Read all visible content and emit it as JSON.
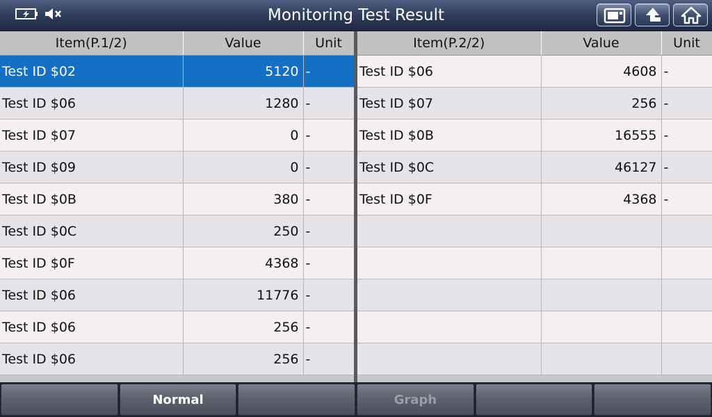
{
  "header": {
    "title": "Monitoring Test Result",
    "status_icons": [
      "battery-charging-icon",
      "speaker-muted-icon"
    ],
    "buttons": [
      "screenshot-icon",
      "back-arrow-icon",
      "home-icon"
    ]
  },
  "left_table": {
    "columns": [
      "Item(P.1/2)",
      "Value",
      "Unit"
    ],
    "rows": [
      {
        "item": "Test ID $02",
        "value": "5120",
        "unit": "-"
      },
      {
        "item": "Test ID $06",
        "value": "1280",
        "unit": "-"
      },
      {
        "item": "Test ID $07",
        "value": "0",
        "unit": "-"
      },
      {
        "item": "Test ID $09",
        "value": "0",
        "unit": "-"
      },
      {
        "item": "Test ID $0B",
        "value": "380",
        "unit": "-"
      },
      {
        "item": "Test ID $0C",
        "value": "250",
        "unit": "-"
      },
      {
        "item": "Test ID $0F",
        "value": "4368",
        "unit": "-"
      },
      {
        "item": "Test ID $06",
        "value": "11776",
        "unit": "-"
      },
      {
        "item": "Test ID $06",
        "value": "256",
        "unit": "-"
      },
      {
        "item": "Test ID $06",
        "value": "256",
        "unit": "-"
      }
    ]
  },
  "right_table": {
    "columns": [
      "Item(P.2/2)",
      "Value",
      "Unit"
    ],
    "rows": [
      {
        "item": "Test ID $06",
        "value": "4608",
        "unit": "-"
      },
      {
        "item": "Test ID $07",
        "value": "256",
        "unit": "-"
      },
      {
        "item": "Test ID $0B",
        "value": "16555",
        "unit": "-"
      },
      {
        "item": "Test ID $0C",
        "value": "46127",
        "unit": "-"
      },
      {
        "item": "Test ID $0F",
        "value": "4368",
        "unit": "-"
      },
      {
        "item": "",
        "value": "",
        "unit": ""
      },
      {
        "item": "",
        "value": "",
        "unit": ""
      },
      {
        "item": "",
        "value": "",
        "unit": ""
      },
      {
        "item": "",
        "value": "",
        "unit": ""
      },
      {
        "item": "",
        "value": "",
        "unit": ""
      }
    ]
  },
  "footer": {
    "buttons": [
      "",
      "Normal",
      "",
      "Graph",
      "",
      ""
    ]
  },
  "colors": {
    "selected_row": "#1470c4",
    "header_bar": "#2d3a58"
  }
}
